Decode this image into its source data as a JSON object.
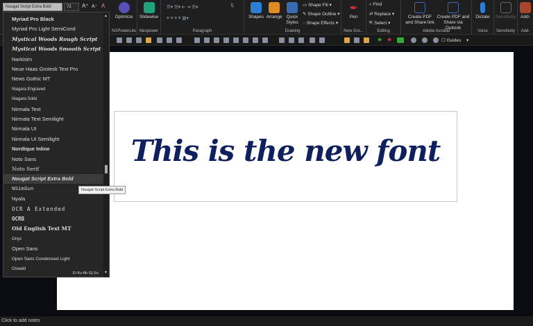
{
  "font_control": {
    "font_name": "Nougat Script Extra Bold",
    "font_size": "72"
  },
  "ribbon": {
    "nxpowerlite": {
      "button": "Optimize",
      "group": "NXPowerLite"
    },
    "neupower": {
      "button": "Slidewise",
      "group": "Neupower"
    },
    "paragraph": {
      "group": "Paragraph"
    },
    "drawing": {
      "shapes": "Shapes",
      "arrange": "Arrange",
      "quick_styles": "Quick Styles",
      "shape_fill": "Shape Fill",
      "shape_outline": "Shape Outline",
      "shape_effects": "Shape Effects",
      "group": "Drawing"
    },
    "new_group": {
      "button": "Pen",
      "group": "New Gro..."
    },
    "editing": {
      "find": "Find",
      "replace": "Replace",
      "select": "Select",
      "group": "Editing"
    },
    "acrobat": {
      "create_link": "Create PDF and Share link",
      "create_outlook": "Create PDF and Share via Outlook",
      "group": "Adobe Acrobat"
    },
    "voice": {
      "button": "Dictate",
      "group": "Voice"
    },
    "sensitivity": {
      "button": "Sensitivity",
      "group": "Sensitivity"
    },
    "addins": {
      "button": "Add-",
      "group": "Add-"
    }
  },
  "toolbar": {
    "guides": "Guides"
  },
  "font_list": [
    "Myriad Pro Black",
    "Myriad Pro Light SemiCond",
    "Mystical Woods Rough Script",
    "Mystical Woods Smooth Script",
    "Narkisim",
    "Neue Haas Grotesk Text Pro",
    "News Gothic MT",
    "Niagara Engraved",
    "Niagara Solid",
    "Nirmala Text",
    "Nirmala Text Semilight",
    "Nirmala UI",
    "Nirmala UI Semilight",
    "Nordique Inline",
    "Noto Sans",
    "Noto Serif",
    "Nougat Script Extra Bold",
    "NSimSun",
    "Nyala",
    "OCR A Extended",
    "OCRB",
    "Old English Text MT",
    "Onyx",
    "Open Sans",
    "Open Sans Condensed Light",
    "Oswald"
  ],
  "font_list_selected": "Nougat Script Extra Bold",
  "oswald_preview": "Ei Ku Ab Gj Uu",
  "tooltip": "Nougat Script Extra Bold",
  "slide": {
    "text": "This is the new font"
  },
  "status": {
    "notes": "Click to add notes"
  }
}
